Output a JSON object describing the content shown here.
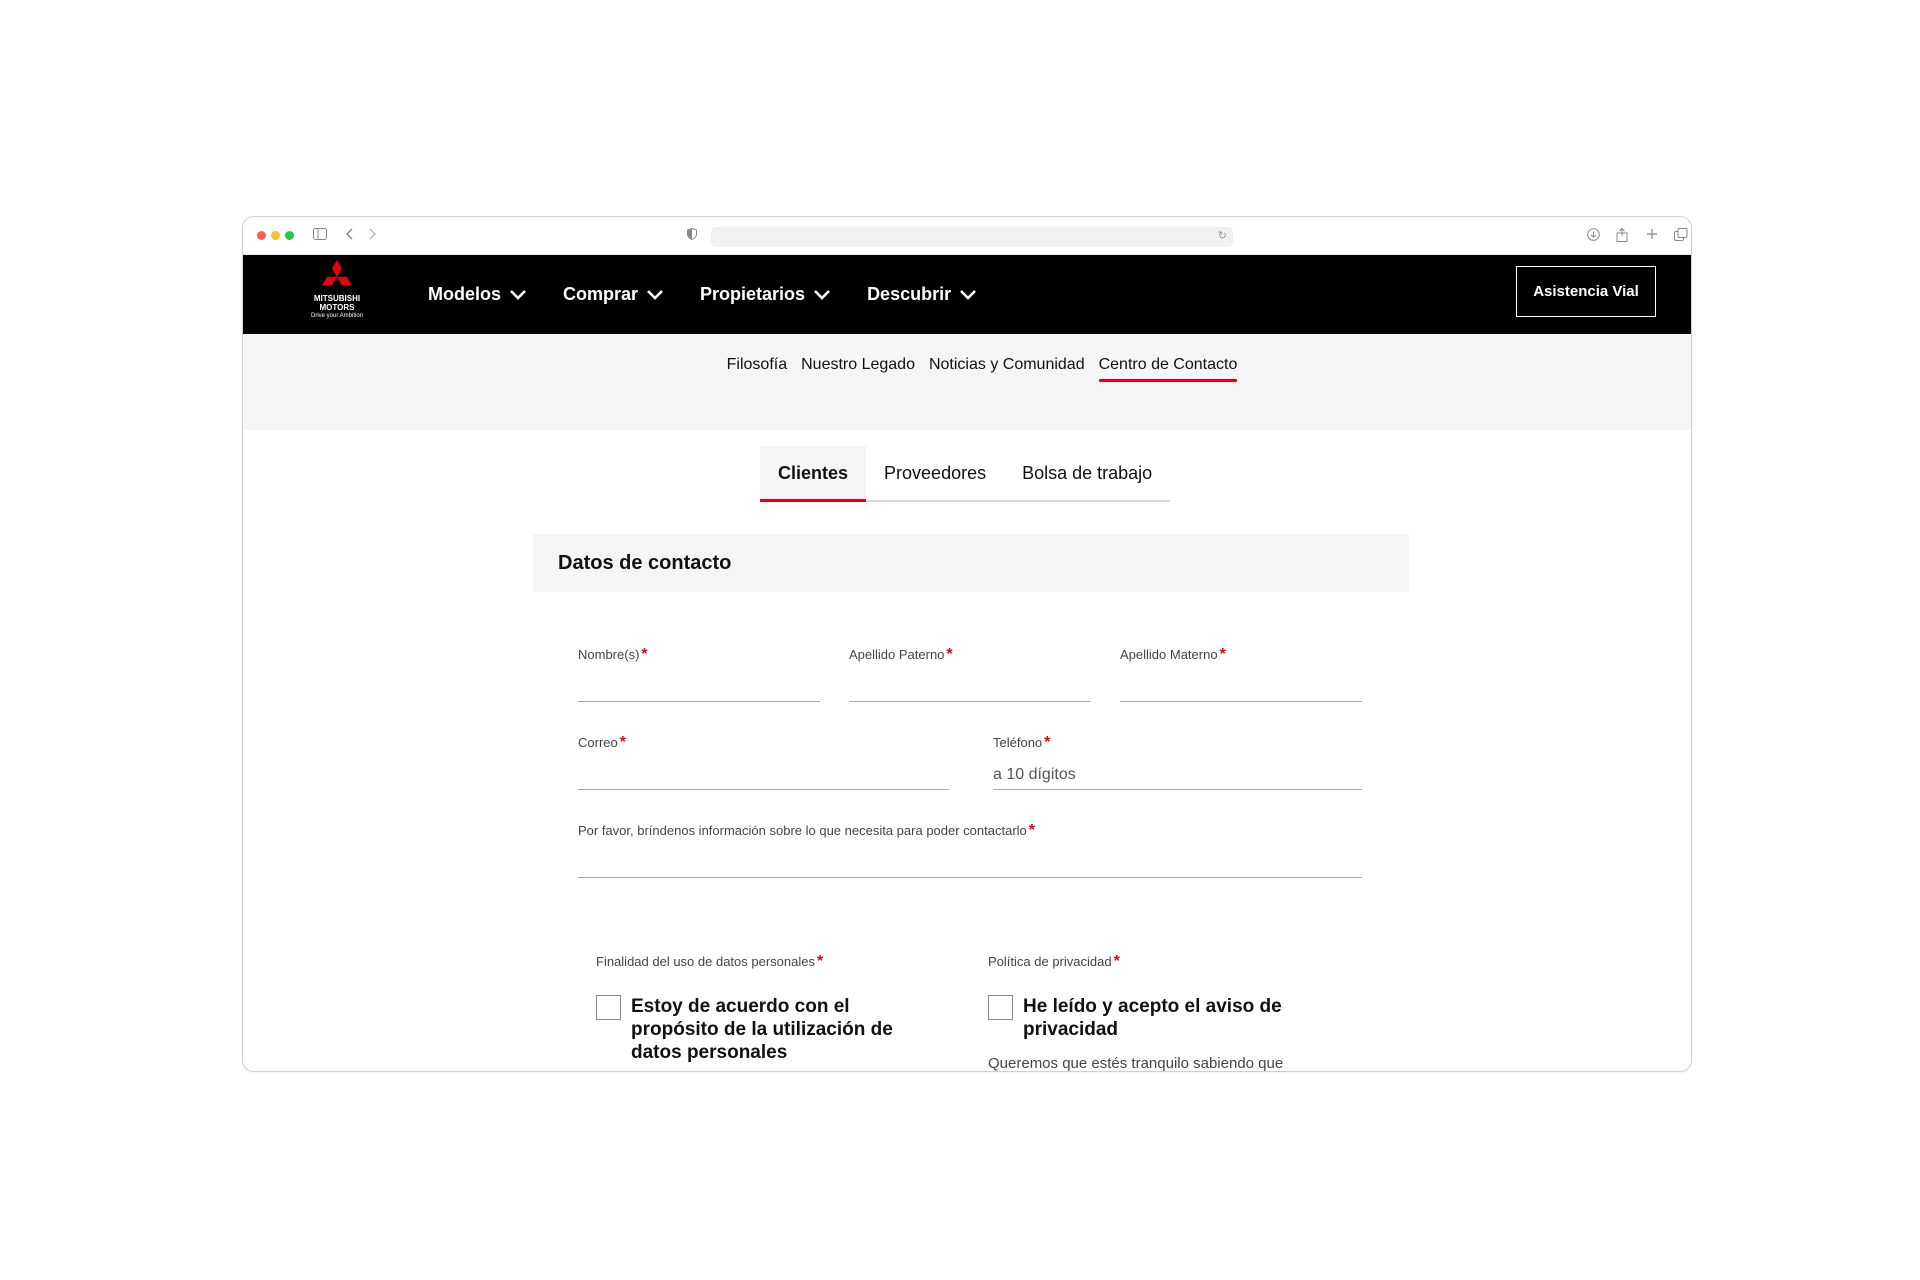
{
  "browser": {
    "traffic_lights": [
      "#ff5f57",
      "#febc2e",
      "#28c840"
    ],
    "url": ""
  },
  "brand": {
    "name_line1": "MITSUBISHI",
    "name_line2": "MOTORS",
    "tagline": "Drive your Ambition",
    "accent_color": "#e60012"
  },
  "mainnav": {
    "items": [
      {
        "label": "Modelos"
      },
      {
        "label": "Comprar"
      },
      {
        "label": "Propietarios"
      },
      {
        "label": "Descubrir"
      }
    ],
    "cta_label": "Asistencia Vial"
  },
  "subnav": {
    "items": [
      {
        "label": "Filosofía"
      },
      {
        "label": "Nuestro Legado"
      },
      {
        "label": "Noticias y Comunidad"
      },
      {
        "label": "Centro de Contacto",
        "active": true
      }
    ]
  },
  "tabs": [
    {
      "label": "Clientes",
      "active": true
    },
    {
      "label": "Proveedores"
    },
    {
      "label": "Bolsa de trabajo"
    }
  ],
  "form": {
    "section_title": "Datos de contacto",
    "required_mark": "*",
    "fields": {
      "nombre": {
        "label": "Nombre(s)",
        "value": "",
        "placeholder": ""
      },
      "apellido_paterno": {
        "label": "Apellido Paterno",
        "value": "",
        "placeholder": ""
      },
      "apellido_materno": {
        "label": "Apellido Materno",
        "value": "",
        "placeholder": ""
      },
      "correo": {
        "label": "Correo",
        "value": "",
        "placeholder": ""
      },
      "telefono": {
        "label": "Teléfono",
        "value": "",
        "placeholder": "a 10 dígitos"
      },
      "mensaje": {
        "label": "Por favor, bríndenos información sobre lo que necesita para poder contactarlo",
        "value": "",
        "placeholder": ""
      }
    },
    "consents": {
      "finalidad": {
        "label": "Finalidad del uso de datos personales",
        "text": "Estoy de acuerdo con el propósito de la utilización de datos personales",
        "checked": false
      },
      "privacidad": {
        "label": "Política de privacidad",
        "text": "He leído y acepto el aviso de privacidad",
        "subtext": "Queremos que estés tranquilo sabiendo que",
        "checked": false
      }
    }
  }
}
